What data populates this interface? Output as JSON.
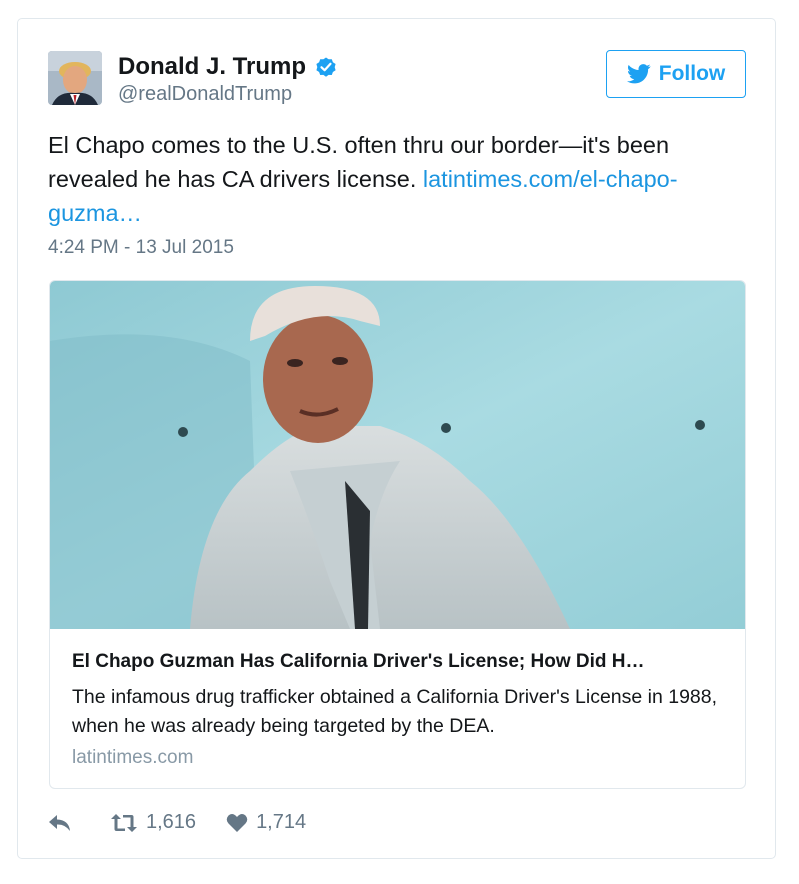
{
  "author": {
    "name": "Donald J. Trump",
    "handle": "@realDonaldTrump",
    "verified": true
  },
  "follow_button": {
    "label": "Follow",
    "icon": "twitter-bird-icon"
  },
  "tweet": {
    "text": "El Chapo comes to the U.S. often thru our border—it's been revealed he has CA drivers license.",
    "link_text": "latintimes.com/el-chapo-guzma…",
    "timestamp": "4:24 PM - 13 Jul 2015"
  },
  "link_card": {
    "title": "El Chapo Guzman Has California Driver's License; How Did H…",
    "description": "The infamous drug trafficker obtained a California Driver's License in 1988, when he was already being targeted by the DEA.",
    "domain": "latintimes.com"
  },
  "actions": {
    "reply_icon": "reply-icon",
    "retweet_icon": "retweet-icon",
    "retweet_count": "1,616",
    "like_icon": "heart-icon",
    "like_count": "1,714"
  },
  "colors": {
    "accent": "#1da1f2",
    "link": "#1b95e0",
    "muted": "#657786",
    "border": "#e1e8ed"
  }
}
